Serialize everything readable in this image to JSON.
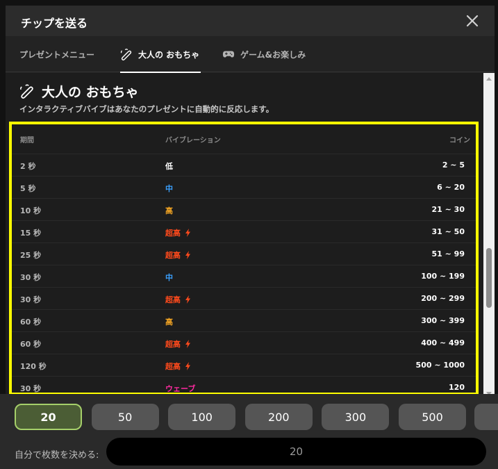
{
  "dialog": {
    "title": "チップを送る",
    "close_icon": "close-icon"
  },
  "tabs": [
    {
      "label": "プレゼントメニュー",
      "icon": null,
      "active": false
    },
    {
      "label": "大人の おもちゃ",
      "icon": "toy-icon",
      "active": true
    },
    {
      "label": "ゲーム&お楽しみ",
      "icon": "gamepad-icon",
      "active": false
    }
  ],
  "section": {
    "icon": "toy-icon",
    "title": "大人の おもちゃ",
    "subtitle": "インタラクティブバイブはあなたのプレゼントに自動的に反応します。"
  },
  "table": {
    "headers": {
      "duration": "期間",
      "vibration": "バイブレーション",
      "coins": "コイン"
    },
    "rows": [
      {
        "duration": "2 秒",
        "vibration": "低",
        "level": "low",
        "coins": "2 ~ 5"
      },
      {
        "duration": "5 秒",
        "vibration": "中",
        "level": "medium",
        "coins": "6 ~ 20"
      },
      {
        "duration": "10 秒",
        "vibration": "高",
        "level": "high",
        "coins": "21 ~ 30"
      },
      {
        "duration": "15 秒",
        "vibration": "超高",
        "level": "ultra",
        "coins": "31 ~ 50"
      },
      {
        "duration": "25 秒",
        "vibration": "超高",
        "level": "ultra",
        "coins": "51 ~ 99"
      },
      {
        "duration": "30 秒",
        "vibration": "中",
        "level": "medium",
        "coins": "100 ~ 199"
      },
      {
        "duration": "30 秒",
        "vibration": "超高",
        "level": "ultra",
        "coins": "200 ~ 299"
      },
      {
        "duration": "60 秒",
        "vibration": "高",
        "level": "high",
        "coins": "300 ~ 399"
      },
      {
        "duration": "60 秒",
        "vibration": "超高",
        "level": "ultra",
        "coins": "400 ~ 499"
      },
      {
        "duration": "120 秒",
        "vibration": "超高",
        "level": "ultra",
        "coins": "500 ~ 1000"
      },
      {
        "duration": "30 秒",
        "vibration": "ウェーブ",
        "level": "wave",
        "coins": "120"
      }
    ]
  },
  "colors": {
    "low": "#ffffff",
    "medium": "#3aa0ff",
    "high": "#f5a623",
    "ultra": "#ff4a1c",
    "wave": "#ff2aa0",
    "highlight_border": "#ffff00",
    "selected_chip": "#4b5d35"
  },
  "amounts": {
    "chips": [
      "20",
      "50",
      "100",
      "200",
      "300",
      "500"
    ],
    "selected": "20",
    "custom_label": "自分で枚数を決める:",
    "custom_value": "20"
  }
}
